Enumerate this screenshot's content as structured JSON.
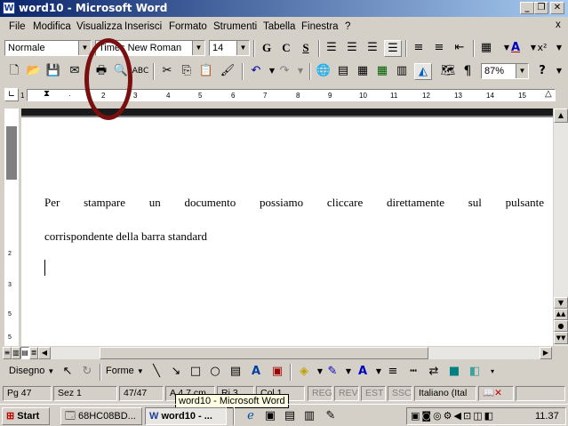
{
  "window": {
    "title": "word10 - Microsoft Word",
    "icon": "word-doc-icon"
  },
  "menubar": {
    "items": [
      "File",
      "Modifica",
      "Visualizza",
      "Inserisci",
      "Formato",
      "Strumenti",
      "Tabella",
      "Finestra",
      "?"
    ],
    "doc_close": "x"
  },
  "formatting": {
    "style": "Normale",
    "font": "Times New Roman",
    "size": "14",
    "bold": "G",
    "italic": "C",
    "underline": "S"
  },
  "standard": {
    "zoom": "87%",
    "help": "?"
  },
  "ruler": {
    "ticks": [
      "1",
      "2",
      "3",
      "4",
      "5",
      "6",
      "7",
      "8",
      "9",
      "10",
      "11",
      "12",
      "13",
      "14",
      "15"
    ]
  },
  "document": {
    "paragraph1": "Per stampare un documento possiamo cliccare direttamente sul pulsante",
    "paragraph2": "corrispondente della barra standard"
  },
  "drawing": {
    "disegno": "Disegno",
    "forme": "Forme"
  },
  "status": {
    "page": "Pg 47",
    "section": "Sez 1",
    "pages": "47/47",
    "at": "A 4,7 cm",
    "row": "Ri 3",
    "col": "Col 1",
    "reg": "REG",
    "rev": "REV",
    "est": "EST",
    "ssc": "SSC",
    "language": "Italiano (Ital"
  },
  "tooltip": "word10 - Microsoft Word",
  "taskbar": {
    "start": "Start",
    "task1": "68HC08BD...",
    "task2": "word10 - ...",
    "clock": "11.37"
  },
  "annotation_color": "#7a0f0f"
}
